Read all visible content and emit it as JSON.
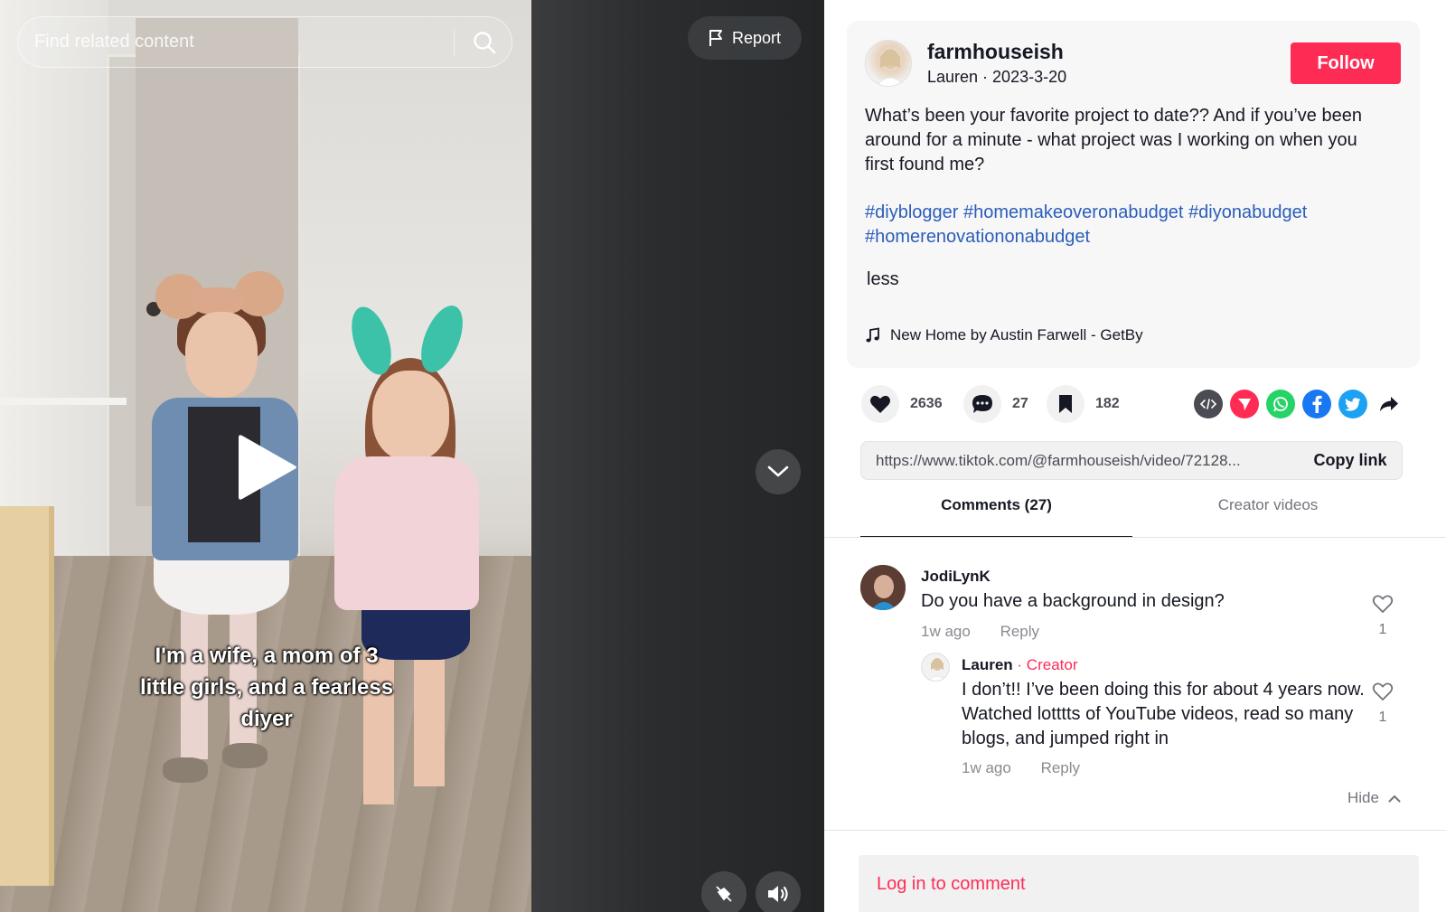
{
  "search": {
    "placeholder": "Find related content"
  },
  "video": {
    "caption_lines": [
      "I'm a wife, a mom of 3",
      "little girls, and a fearless",
      "diyer"
    ],
    "report_label": "Report"
  },
  "post": {
    "author_username": "farmhouseish",
    "author_subline": "Lauren · 2023-3-20",
    "follow_label": "Follow",
    "description": "What’s been your favorite project to date?? And if you’ve been around for a minute - what project was I working on when you first found me?",
    "hashtags": [
      "#diyblogger",
      "#homemakeoveronabudget",
      "#diyonabudget",
      "#homerenovationonabudget"
    ],
    "less_label": "less",
    "music": "New Home by Austin Farwell - GetBy"
  },
  "actions": {
    "likes": "2636",
    "comments": "27",
    "saves": "182",
    "share_icons": [
      "embed-icon",
      "send-icon",
      "whatsapp-icon",
      "facebook-icon",
      "twitter-icon",
      "share-arrow-icon"
    ]
  },
  "link": {
    "url": "https://www.tiktok.com/@farmhouseish/video/72128...",
    "copy_label": "Copy link"
  },
  "tabs": {
    "comments": "Comments (27)",
    "creator_videos": "Creator videos"
  },
  "comments": [
    {
      "user": "JodiLynK",
      "text": "Do you have a background in design?",
      "time": "1w ago",
      "reply_label": "Reply",
      "likes": "1"
    }
  ],
  "reply": {
    "user": "Lauren",
    "separator": " · ",
    "creator_tag": "Creator",
    "text": "I don’t!! I’ve been doing this for about 4 years now. Watched lotttts of YouTube videos, read so many blogs, and jumped right in",
    "time": "1w ago",
    "reply_label": "Reply",
    "likes": "1"
  },
  "hide_label": "Hide",
  "login_prompt": "Log in to comment",
  "colors": {
    "brand": "#fe2c55",
    "hashtag": "#2b5db9",
    "muted": "#8a8b91"
  }
}
